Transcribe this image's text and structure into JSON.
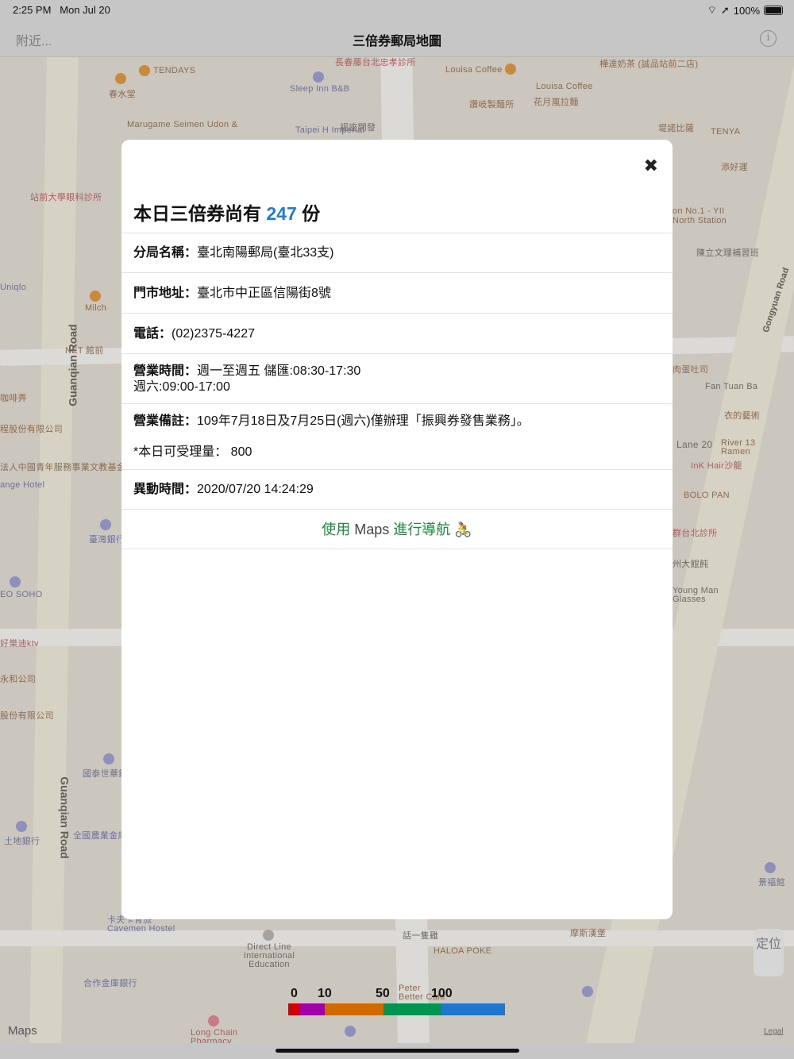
{
  "status_bar": {
    "time": "2:25 PM",
    "date": "Mon Jul 20",
    "battery": "100%"
  },
  "nav": {
    "left": "附近...",
    "title": "三倍券郵局地圖",
    "info_icon": "info-icon"
  },
  "modal": {
    "headline_pre": "本日三倍券尚有 ",
    "count": "247",
    "headline_post": " 份",
    "close": "✖",
    "rows": [
      {
        "label": "分局名稱：",
        "value": "臺北南陽郵局(臺北33支)"
      },
      {
        "label": "門市地址：",
        "value": "臺北市中正區信陽街8號"
      },
      {
        "label": "電話：",
        "value": "(02)2375-4227"
      },
      {
        "label": "營業時間：",
        "value": "週一至週五 儲匯:08:30-17:30",
        "value2": "週六:09:00-17:00"
      },
      {
        "label": "營業備註：",
        "value": "109年7月18日及7月25日(週六)僅辦理「振興券發售業務」。",
        "value2": "*本日可受理量： 800"
      },
      {
        "label": "異動時間：",
        "value": "2020/07/20 14:24:29"
      }
    ],
    "navigate": {
      "pre": "使用 ",
      "apple": "",
      "maps": "Maps",
      "post": " 進行導航 ",
      "emoji": "🚴"
    }
  },
  "legend": {
    "ticks": [
      "0",
      "10",
      "50",
      "100"
    ],
    "colors": [
      "#d10000",
      "#a000a8",
      "#d06a00",
      "#009450",
      "#2075cc"
    ],
    "bounds": [
      0,
      5,
      10,
      50,
      100,
      160
    ]
  },
  "map": {
    "roads": [
      "Guanqian Road",
      "Guanqian Road",
      "Gongyuan Road"
    ],
    "labels": [
      "TENDAYS",
      "春水堂",
      "長春藤台北忠孝診所",
      "Sleep Inn B&B",
      "Louisa Coffee",
      "Louisa Coffee",
      "樺達奶茶 (誠品站前二店)",
      "讚岐製麵所",
      "花月嵐拉麵",
      "Marugame Seimen Udon &",
      "Taipei H Imperial",
      "福座開發",
      "堤諾比薩",
      "TENYA",
      "添好運",
      "站前大學眼科診所",
      "Milch",
      "NET 館前",
      "Uniqlo",
      "on No.1 - YII North Station",
      "陳立文理補習班",
      "肉蛋吐司",
      "Fan Tuan Ba",
      "衣的藝術",
      "Lane 20",
      "River 13 Ramen",
      "InK Hair沙龍",
      "BOLO PAN",
      "群台北診所",
      "州大餛飩",
      "Young Man Glasses",
      "臺灣銀行",
      "EO SOHO",
      "好樂迪ktv",
      "永和公司",
      "國泰世華銀",
      "土地銀行",
      "全國農業金庫",
      "卡夫卡青旅 Cavemen Hostel",
      "Direct Line International Education",
      "合作金庫銀行",
      "話一隻雞",
      "HALOA POKE",
      "摩斯漢堡",
      "Peter Better Cafe",
      "Long Chain Pharmacy",
      "景福館",
      "程股份有限公司",
      "法人中國青年服務事業文教基金",
      "ange Hotel",
      "咖啡弄",
      "股份有限公司"
    ],
    "locate": "定位",
    "maps_logo": "Maps",
    "legal": "Legal"
  }
}
